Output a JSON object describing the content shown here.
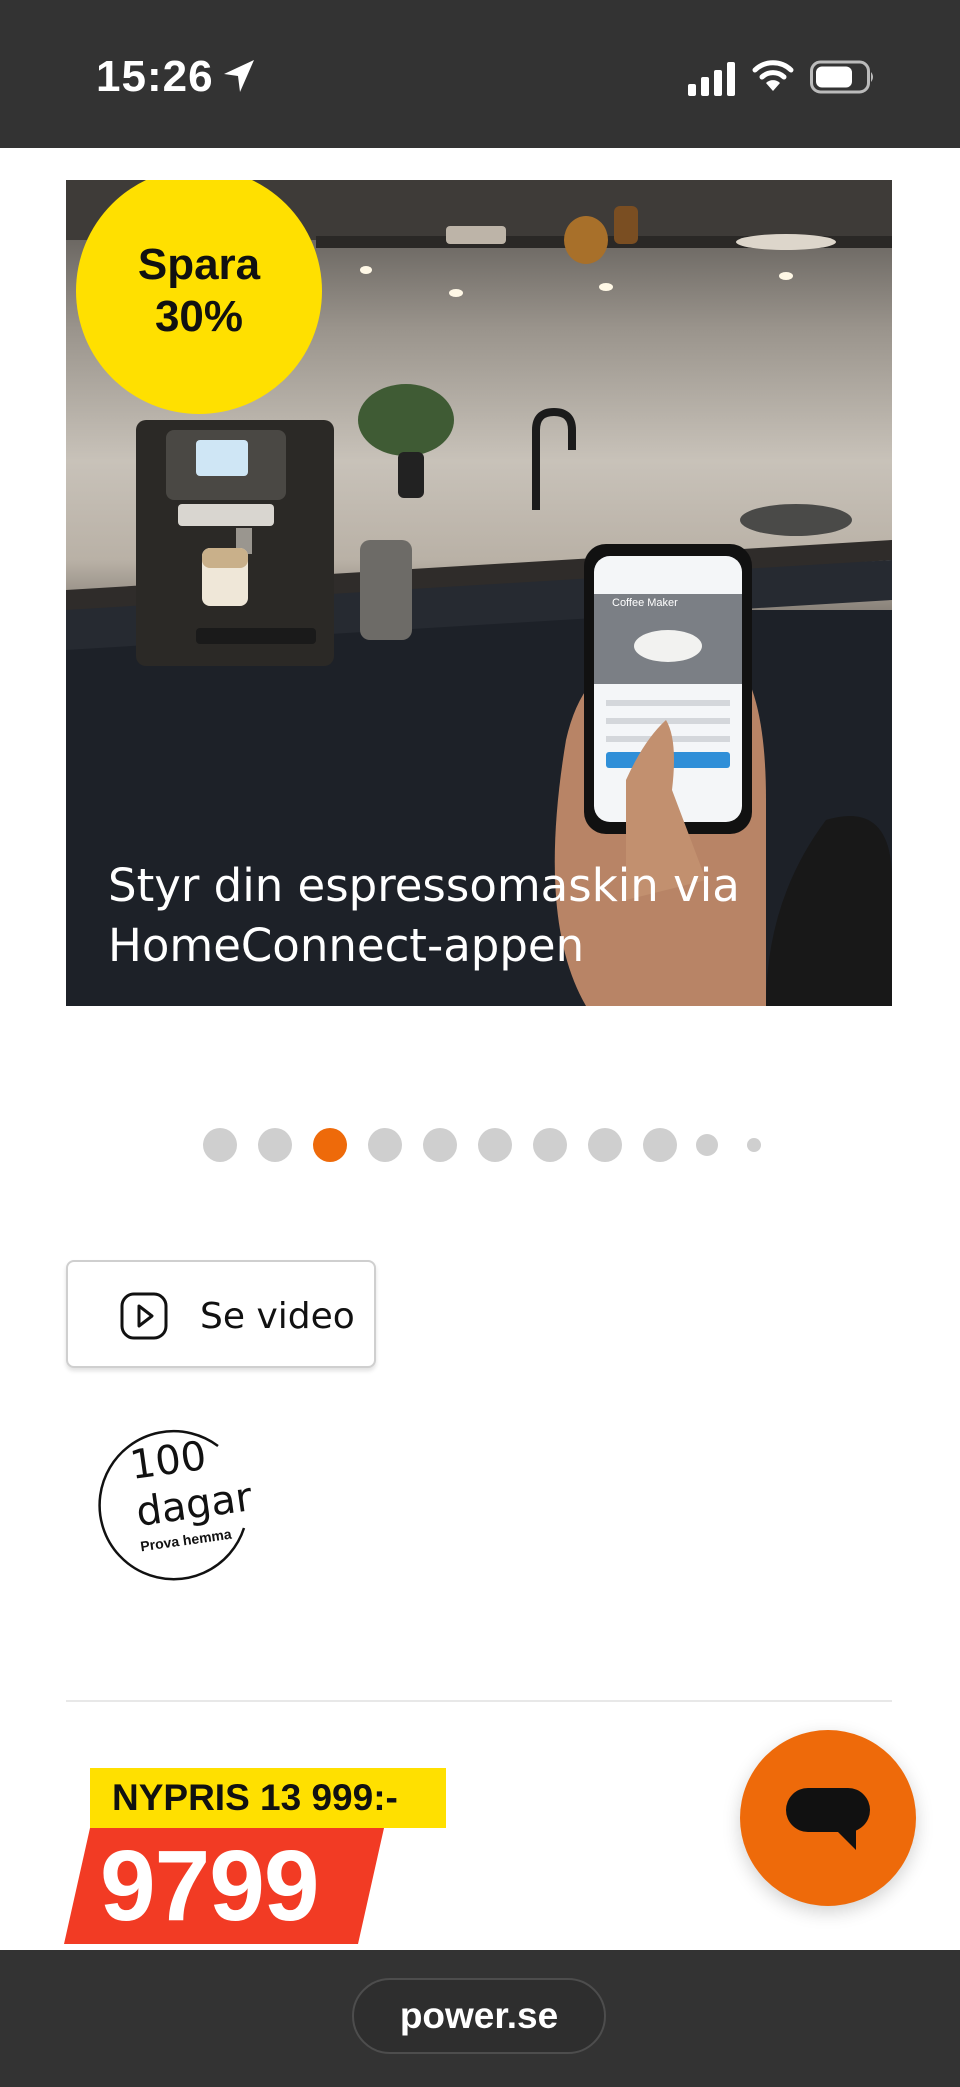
{
  "status_bar": {
    "time": "15:26",
    "icons": [
      "location-arrow-icon",
      "cellular-signal-icon",
      "wifi-icon",
      "battery-icon"
    ]
  },
  "hero": {
    "badge_line1": "Spara",
    "badge_line2": "30%",
    "caption_line1": "Styr din espressomaskin via",
    "caption_line2": "HomeConnect-appen",
    "phone_screen_title": "Coffee Maker"
  },
  "carousel": {
    "total_dots": 11,
    "active_index": 2
  },
  "video_button": {
    "icon": "play-icon",
    "label": "Se video"
  },
  "trial_badge": {
    "number": "100",
    "unit": "dagar",
    "subtitle": "Prova hemma"
  },
  "price": {
    "old_price_label": "NYPRIS 13 999:-",
    "current_price": "9799"
  },
  "chat_button": {
    "icon": "chat-bubble-icon"
  },
  "browser": {
    "url": "power.se"
  },
  "colors": {
    "status_bar_bg": "#333333",
    "promo_yellow": "#ffe000",
    "price_red": "#f23b24",
    "accent_orange": "#ee6a0a",
    "dot_inactive": "#cfcfcf"
  }
}
